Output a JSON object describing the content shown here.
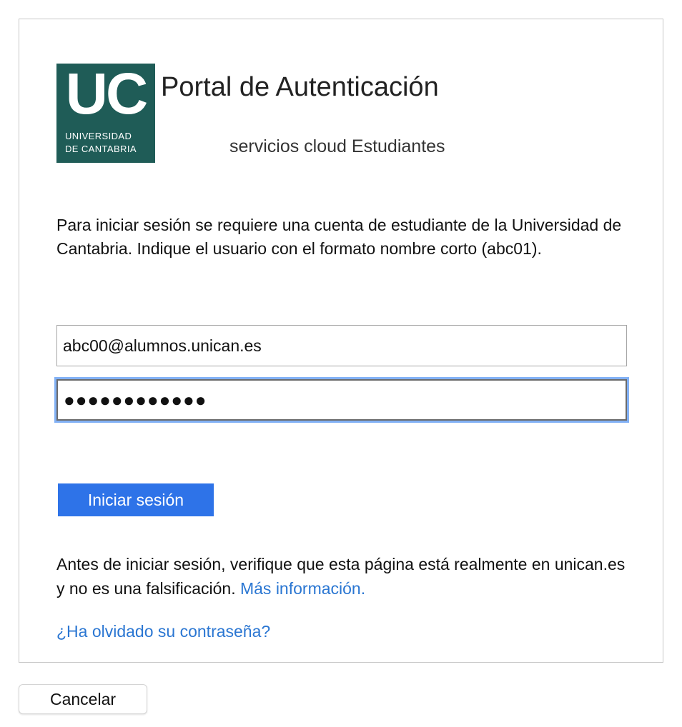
{
  "logo": {
    "mark": "UC",
    "line1": "UNIVERSIDAD",
    "line2": "DE CANTABRIA"
  },
  "header": {
    "title": "Portal de Autenticación",
    "subtitle": "servicios cloud Estudiantes"
  },
  "intro_text": "Para iniciar sesión se requiere una cuenta de estudiante de la Universidad de Cantabria. Indique el usuario con el formato nombre corto (abc01).",
  "form": {
    "username_value": "abc00@alumnos.unican.es",
    "password_value": "●●●●●●●●●●●●",
    "signin_label": "Iniciar sesión"
  },
  "notice": {
    "text": "Antes de iniciar sesión, verifique que esta página está realmente en unican.es y no es una falsificación.",
    "more_info_link": "Más información."
  },
  "forgot_password_link": "¿Ha olvidado su contraseña?",
  "cancel_label": "Cancelar",
  "colors": {
    "logo_background": "#1f5c57",
    "primary_button": "#2e73e8",
    "link": "#2a76d2",
    "focus_ring": "#82b1f5"
  }
}
